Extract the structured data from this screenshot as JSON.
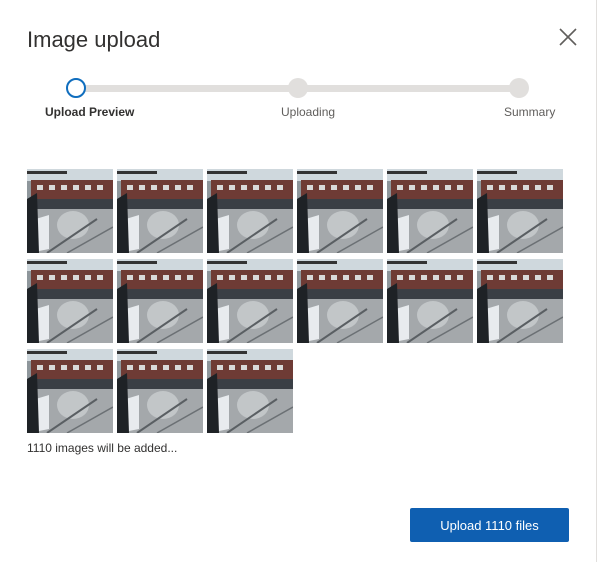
{
  "dialog": {
    "title": "Image upload",
    "close_icon": "close-icon"
  },
  "steps": [
    {
      "label": "Upload Preview",
      "state": "active"
    },
    {
      "label": "Uploading",
      "state": "pending"
    },
    {
      "label": "Summary",
      "state": "pending"
    }
  ],
  "preview": {
    "thumbnail_count_shown": 15,
    "summary_text": "1110 images will be added..."
  },
  "actions": {
    "upload_label": "Upload 1110 files"
  },
  "colors": {
    "accent": "#0f5fb1",
    "active_step": "#106ebe",
    "track": "#e1dfdd"
  }
}
